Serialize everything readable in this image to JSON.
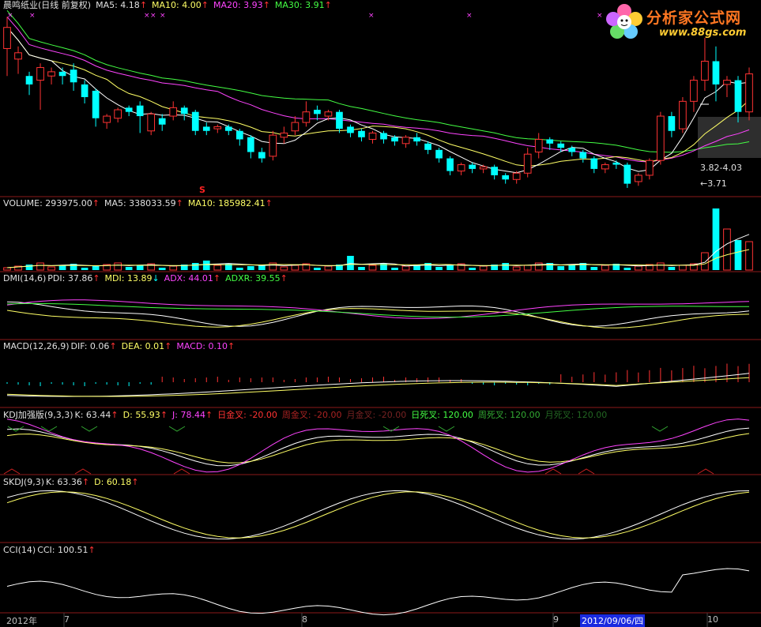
{
  "main": {
    "stock": "晨鸣纸业(日线 前复权)",
    "ma5": "MA5: 4.18",
    "ma10": "MA10: 4.00",
    "ma20": "MA20: 3.93",
    "ma30": "MA30: 3.91",
    "range_label": "3.82-4.03",
    "low_label": "3.71",
    "signal_mark": "S"
  },
  "volume": {
    "label": "VOLUME: 293975.00",
    "ma5": "MA5: 338033.59",
    "ma10": "MA10: 185982.41"
  },
  "dmi": {
    "label": "DMI(14,6)",
    "pdi": "PDI: 37.86",
    "mdi": "MDI: 13.89",
    "adx": "ADX: 44.01",
    "adxr": "ADXR: 39.55"
  },
  "macd": {
    "label": "MACD(12,26,9)",
    "dif": "DIF: 0.06",
    "dea": "DEA: 0.01",
    "macd": "MACD: 0.10"
  },
  "kdj": {
    "label": "KDJ加强版(9,3,3)",
    "k": "K: 63.44",
    "d": "D: 55.93",
    "j": "J: 78.44",
    "dgc": "日金叉: -20.00",
    "wgc": "周金叉: -20.00",
    "mgc": "月金叉: -20.00",
    "ddc": "日死叉: 120.00",
    "wdc": "周死叉: 120.00",
    "mdc": "月死叉: 120.00"
  },
  "skdj": {
    "label": "SKDJ(9,3)",
    "k": "K: 63.36",
    "d": "D: 60.18"
  },
  "cci": {
    "label": "CCI(14)",
    "cci": "CCI: 100.51"
  },
  "logo": {
    "title": "分析家公式网",
    "url": "www.88gs.com"
  },
  "timeaxis": {
    "year": "2012年",
    "m7": "7",
    "m8": "8",
    "m9": "9",
    "selected": "2012/09/06/四",
    "m10": "10"
  },
  "colors": {
    "up": "#ff3333",
    "down": "#00ffff",
    "ma5": "#ffffff",
    "ma10": "#ffff66",
    "ma20": "#ff44ff",
    "ma30": "#44ff44",
    "background": "#000000"
  },
  "chart_data": {
    "type": "candlestick",
    "series": [
      {
        "name": "K",
        "values": [
          4.35,
          4.28,
          4.22,
          4.18,
          4.2,
          4.24,
          4.15,
          4.09,
          3.98,
          4.02,
          4.05,
          4.08,
          4.06,
          4.05,
          3.96,
          4.03,
          4.05,
          4.08,
          4.0,
          4.02,
          4.03,
          4.04,
          3.98,
          3.88,
          3.86,
          3.93,
          3.97,
          4.05,
          4.1,
          4.07,
          4.05,
          3.97,
          3.95,
          3.98,
          3.92,
          3.93,
          3.9,
          3.92,
          3.88,
          3.82,
          3.78,
          3.79,
          3.8,
          3.76,
          3.73,
          3.75,
          3.83,
          3.92,
          3.9,
          3.88,
          3.86,
          3.79,
          3.8,
          3.82,
          3.72,
          4.29,
          4.2,
          4.23
        ]
      },
      {
        "name": "D",
        "values": [
          4.4,
          4.33,
          4.26,
          4.24,
          4.22,
          4.24,
          4.22,
          4.18,
          4.12,
          4.08,
          4.06,
          4.06,
          4.05,
          4.04,
          4.02,
          4.01,
          4.02,
          4.04,
          4.02,
          4.03,
          4.02,
          4.01,
          4.0,
          3.96,
          3.93,
          3.93,
          3.94,
          3.98,
          4.02,
          4.04,
          4.04,
          4.02,
          3.99,
          3.98,
          3.96,
          3.95,
          3.93,
          3.92,
          3.91,
          3.88,
          3.85,
          3.83,
          3.81,
          3.79,
          3.77,
          3.77,
          3.78,
          3.82,
          3.85,
          3.87,
          3.87,
          3.86,
          3.84,
          3.83,
          3.8,
          3.9,
          3.98,
          4.18
        ]
      }
    ]
  }
}
